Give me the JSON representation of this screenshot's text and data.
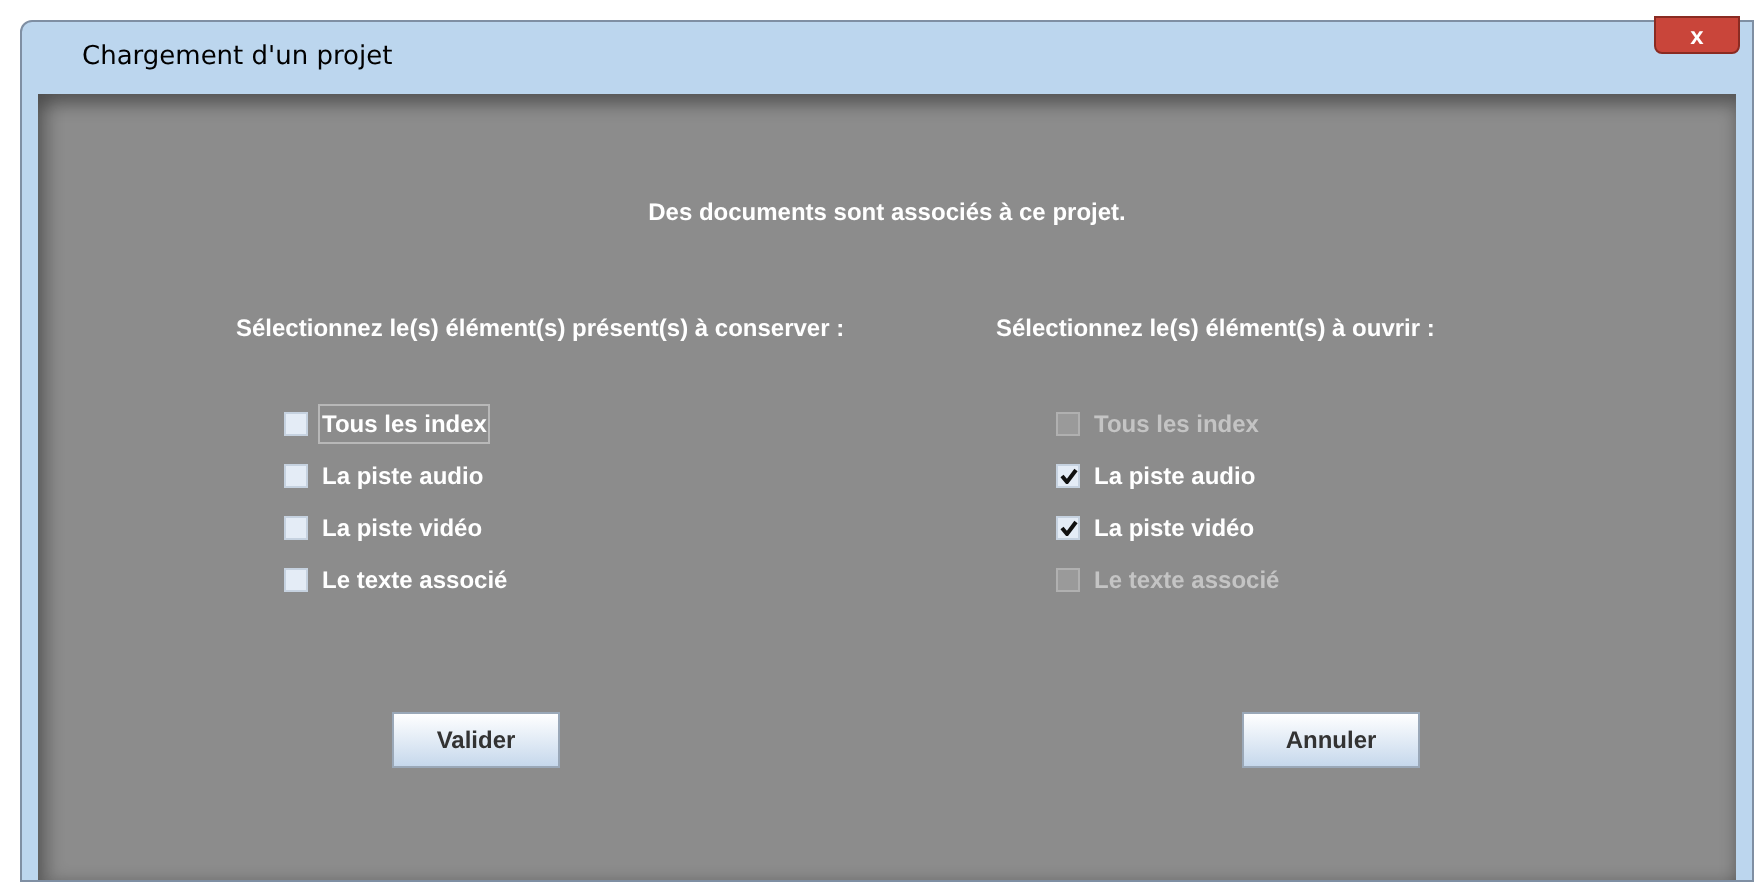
{
  "window": {
    "title": "Chargement d'un projet",
    "close": "x"
  },
  "message": "Des documents sont associés à ce projet.",
  "columns": [
    {
      "heading": "Sélectionnez le(s) élément(s) présent(s) à conserver :",
      "options": [
        {
          "label": "Tous les index",
          "checked": false,
          "disabled": false,
          "focused": true
        },
        {
          "label": "La piste audio",
          "checked": false,
          "disabled": false,
          "focused": false
        },
        {
          "label": "La piste vidéo",
          "checked": false,
          "disabled": false,
          "focused": false
        },
        {
          "label": "Le texte associé",
          "checked": false,
          "disabled": false,
          "focused": false
        }
      ]
    },
    {
      "heading": "Sélectionnez le(s) élément(s) à ouvrir :",
      "options": [
        {
          "label": "Tous les index",
          "checked": false,
          "disabled": true,
          "focused": false
        },
        {
          "label": "La piste audio",
          "checked": true,
          "disabled": false,
          "focused": false
        },
        {
          "label": "La piste vidéo",
          "checked": true,
          "disabled": false,
          "focused": false
        },
        {
          "label": "Le texte associé",
          "checked": false,
          "disabled": true,
          "focused": false
        }
      ]
    }
  ],
  "buttons": [
    "Valider",
    "Annuler"
  ]
}
